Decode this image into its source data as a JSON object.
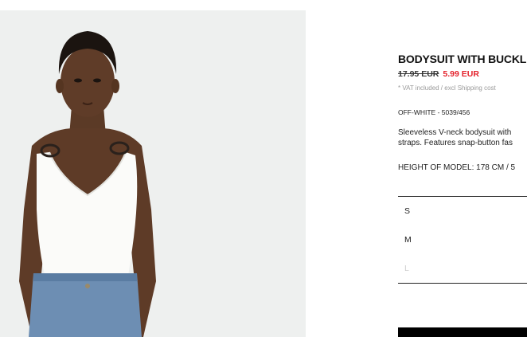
{
  "product": {
    "title": "BODYSUIT WITH BUCKLE",
    "old_price": "17.95 EUR",
    "sale_price": "5.99 EUR",
    "tax_note": "* VAT included / excl Shipping cost",
    "reference": "OFF-WHITE - 5039/456",
    "description_line1": "Sleeveless V-neck bodysuit with",
    "description_line2": "straps. Features snap-button fas",
    "model_height": "HEIGHT OF MODEL: 178 CM / 5"
  },
  "sizes": [
    {
      "label": "S",
      "available": true
    },
    {
      "label": "M",
      "available": true
    },
    {
      "label": "L",
      "available": false
    }
  ],
  "colors": {
    "sale": "#e4202a",
    "photo_background": "#eef0ef",
    "unavailable_size": "#cfcfcf"
  }
}
